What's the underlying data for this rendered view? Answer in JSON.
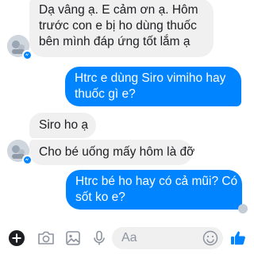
{
  "conversation": {
    "messages": [
      {
        "side": "incoming",
        "lines": [
          "Dạ vâng ạ. E cảm ơn ạ. Hôm",
          "trước con e bị ho dùng thuốc",
          "bên mình đáp ứng tốt lắm ạ"
        ]
      },
      {
        "side": "outgoing",
        "lines": [
          "Htrc e dùng Siro vimiho hay",
          "thuốc gì e?"
        ]
      },
      {
        "side": "incoming",
        "lines": [
          "Siro ho ạ"
        ]
      },
      {
        "side": "incoming",
        "lines": [
          "Cho bé uống mấy hôm là đỡ"
        ]
      },
      {
        "side": "outgoing",
        "lines": [
          "Htrc bé ho hay có cả mũi? Có",
          "sốt ko e?"
        ]
      }
    ]
  },
  "composer": {
    "placeholder": "Aa",
    "icons": [
      "plus-icon",
      "camera-icon",
      "gallery-icon",
      "microphone-icon",
      "emoji-icon",
      "thumbs-up-icon"
    ]
  },
  "colors": {
    "outgoing_bubble": "#0084ff",
    "incoming_bubble": "#f1f0f0",
    "accent": "#0084ff"
  }
}
